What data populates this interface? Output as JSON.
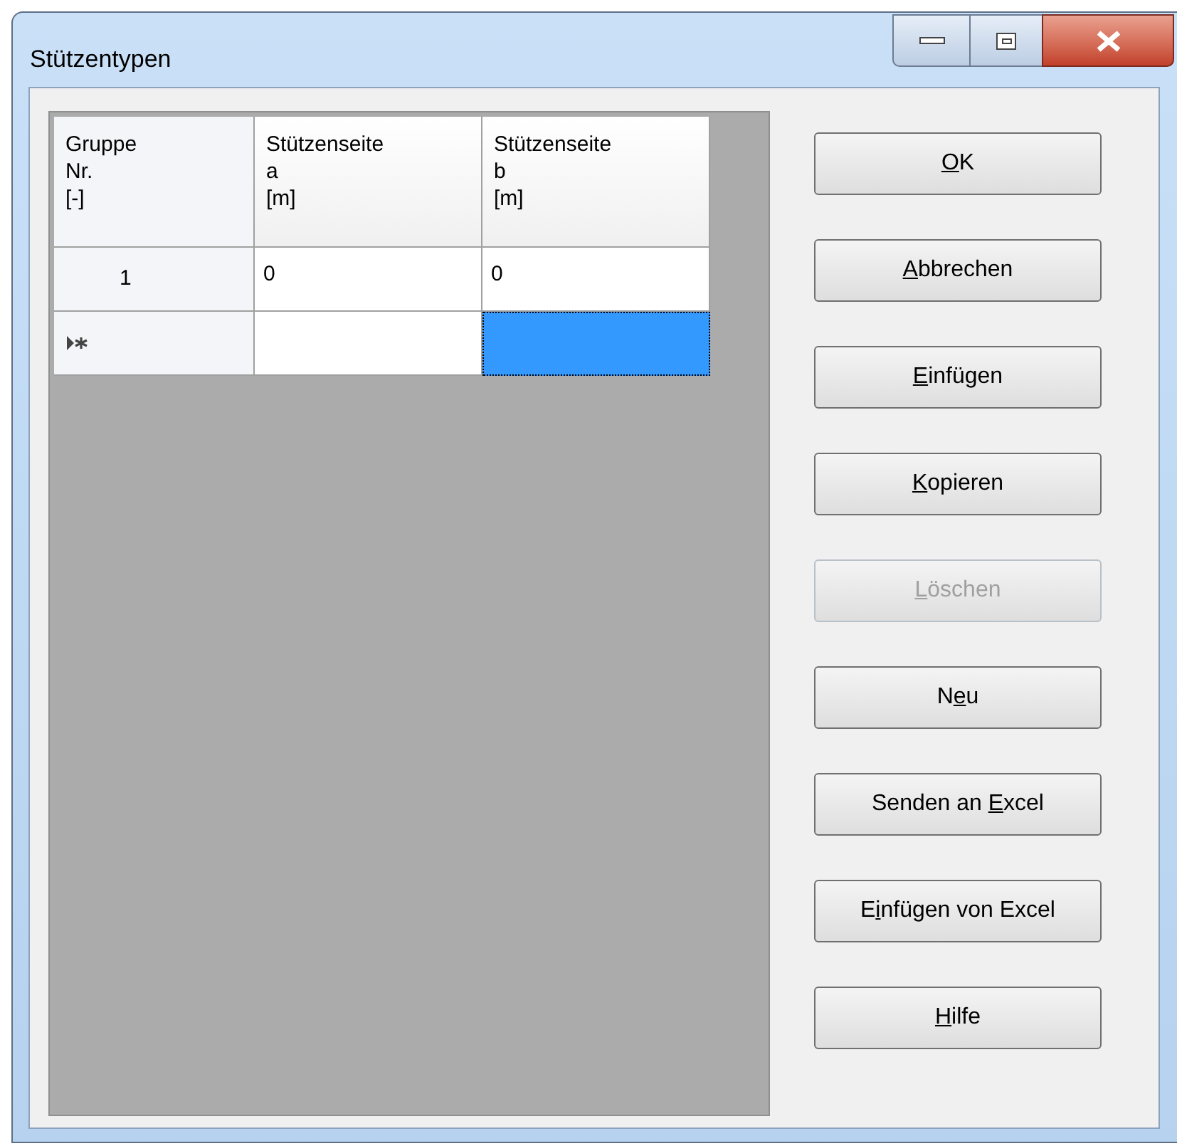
{
  "window": {
    "title": "Stützentypen"
  },
  "table": {
    "columns": [
      {
        "lines": [
          "Gruppe",
          "Nr.",
          "[-]"
        ]
      },
      {
        "lines": [
          "Stützenseite",
          "a",
          "[m]"
        ]
      },
      {
        "lines": [
          "Stützenseite",
          "b",
          "[m]"
        ]
      }
    ],
    "rows": [
      {
        "kind": "data",
        "cells": [
          {
            "text": "1",
            "selected": false
          },
          {
            "text": "0",
            "selected": false
          },
          {
            "text": "0",
            "selected": false
          }
        ]
      },
      {
        "kind": "new",
        "cells": [
          {
            "selected": false
          },
          {
            "selected": false
          },
          {
            "selected": true
          }
        ]
      }
    ]
  },
  "buttons": [
    {
      "label": {
        "key": "O",
        "post": "K"
      },
      "disabled": false
    },
    {
      "label": {
        "key": "A",
        "post": "bbrechen"
      },
      "disabled": false
    },
    {
      "label": {
        "key": "E",
        "post": "infügen"
      },
      "disabled": false
    },
    {
      "label": {
        "key": "K",
        "post": "opieren"
      },
      "disabled": false
    },
    {
      "label": {
        "key": "L",
        "post": "öschen"
      },
      "disabled": true
    },
    {
      "label": {
        "pre": "N",
        "key": "e",
        "post": "u"
      },
      "disabled": false
    },
    {
      "label": {
        "pre": "Senden an ",
        "key": "E",
        "post": "xcel"
      },
      "disabled": false
    },
    {
      "label": {
        "pre": "E",
        "key": "i",
        "post": "nfügen von Excel"
      },
      "disabled": false
    },
    {
      "label": {
        "key": "H",
        "post": "ilfe"
      },
      "disabled": false
    }
  ]
}
